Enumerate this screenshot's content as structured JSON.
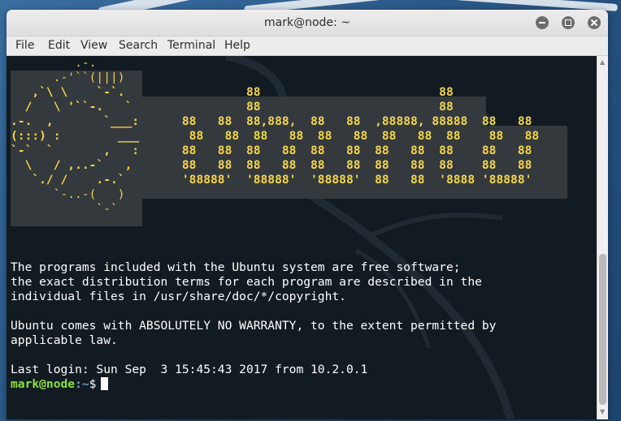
{
  "window": {
    "title": "mark@node: ~",
    "menu": [
      "File",
      "Edit",
      "View",
      "Search",
      "Terminal",
      "Help"
    ]
  },
  "terminal": {
    "logo_lines": [
      "         .-.",
      "      .-'``(|||)",
      "   ,`\\ \\    `-`.                 88                         88",
      "  /   \\ '``-.   `                88                         88",
      ".-.  ,       `___:      88   88  88,888,  88   88  ,88888, 88888  88   88",
      "(:::) :        ___       88   88  88   88  88   88  88   88  88    88   88",
      "`-`  `       ,   :      88   88  88   88  88   88  88   88  88    88   88",
      "  \\   / ,..-`   ,       88   88  88   88  88   88  88   88  88    88   88",
      "   `./ /    .-.`        '88888'  '88888'  '88888'  88   88  '8888 '88888'",
      "      `-..-(   )",
      "            `-`"
    ],
    "message_lines": [
      "The programs included with the Ubuntu system are free software;",
      "the exact distribution terms for each program are described in the",
      "individual files in /usr/share/doc/*/copyright.",
      "",
      "Ubuntu comes with ABSOLUTELY NO WARRANTY, to the extent permitted by",
      "applicable law.",
      "",
      "Last login: Sun Sep  3 15:45:43 2017 from 10.2.0.1"
    ],
    "prompt_user_host": "mark@node",
    "prompt_path": ":~",
    "prompt_symbol": "$"
  },
  "colors": {
    "terminal_bg": "#131b22",
    "logo_fg": "#f0d054",
    "prompt_user": "#8ae234",
    "prompt_path": "#729fcf"
  }
}
